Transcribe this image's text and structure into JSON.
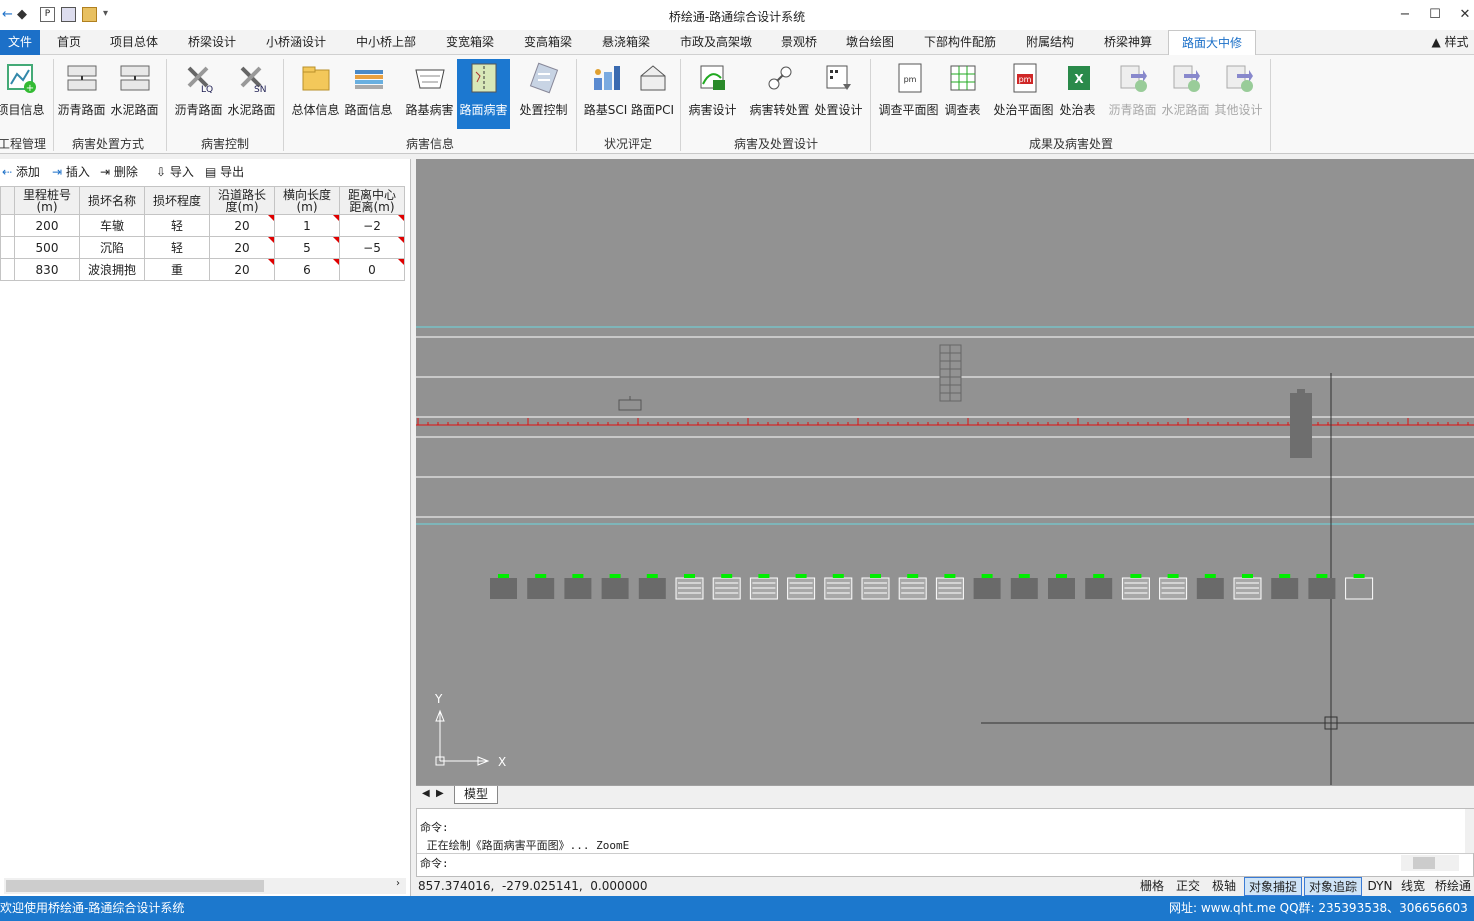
{
  "title": "桥绘通-路通综合设计系统",
  "titlebar": {
    "minimize": "−",
    "maximize": "☐",
    "close": "✕"
  },
  "menu": {
    "file": "文件",
    "items": [
      "首页",
      "项目总体",
      "桥梁设计",
      "小桥涵设计",
      "中小桥上部",
      "变宽箱梁",
      "变高箱梁",
      "悬浇箱梁",
      "市政及高架墩",
      "景观桥",
      "墩台绘图",
      "下部构件配筋",
      "附属结构",
      "桥梁神算",
      "路面大中修"
    ],
    "active": "路面大中修",
    "style": "▲ 样式"
  },
  "ribbon": {
    "buttons": [
      {
        "label": "项目信息",
        "icon": "project-info-icon"
      },
      {
        "label": "沥青路面",
        "icon": "asphalt-method-icon"
      },
      {
        "label": "水泥路面",
        "icon": "cement-method-icon"
      },
      {
        "label": "沥青路面",
        "icon": "asphalt-control-icon"
      },
      {
        "label": "水泥路面",
        "icon": "cement-control-icon"
      },
      {
        "label": "总体信息",
        "icon": "folder-icon"
      },
      {
        "label": "路面信息",
        "icon": "pavement-info-icon"
      },
      {
        "label": "路基病害",
        "icon": "subgrade-disease-icon"
      },
      {
        "label": "路面病害",
        "icon": "pavement-disease-icon",
        "selected": true
      },
      {
        "label": "处置控制",
        "icon": "disposal-control-icon"
      },
      {
        "label": "路基SCI",
        "icon": "sci-icon"
      },
      {
        "label": "路面PCI",
        "icon": "pci-icon"
      },
      {
        "label": "病害设计",
        "icon": "disease-design-icon"
      },
      {
        "label": "病害转处置",
        "icon": "disease-convert-icon"
      },
      {
        "label": "处置设计",
        "icon": "disposal-design-icon"
      },
      {
        "label": "调查平面图",
        "icon": "survey-plan-icon"
      },
      {
        "label": "调查表",
        "icon": "survey-table-icon"
      },
      {
        "label": "处治平面图",
        "icon": "treatment-plan-icon"
      },
      {
        "label": "处治表",
        "icon": "excel-icon"
      },
      {
        "label": "沥青路面",
        "icon": "asphalt-export-icon",
        "disabled": true
      },
      {
        "label": "水泥路面",
        "icon": "cement-export-icon",
        "disabled": true
      },
      {
        "label": "其他设计",
        "icon": "other-export-icon",
        "disabled": true
      }
    ],
    "groups": [
      "工程管理",
      "病害处置方式",
      "病害控制",
      "病害信息",
      "状况评定",
      "病害及处置设计",
      "成果及病害处置"
    ]
  },
  "toolbar": {
    "add": "添加",
    "insert": "插入",
    "delete": "删除",
    "import": "导入",
    "export": "导出"
  },
  "table": {
    "headers": [
      "里程桩号\n(m)",
      "损坏名称",
      "损坏程度",
      "沿道路长\n度(m)",
      "横向长度\n(m)",
      "距离中心\n距离(m)"
    ],
    "rows": [
      [
        "200",
        "车辙",
        "轻",
        "20",
        "1",
        "−2"
      ],
      [
        "500",
        "沉陷",
        "轻",
        "20",
        "5",
        "−5"
      ],
      [
        "830",
        "波浪拥抱",
        "重",
        "20",
        "6",
        "0"
      ]
    ]
  },
  "drawing": {
    "ucs_y": "Y",
    "ucs_x": "X"
  },
  "tabs": {
    "model": "模型"
  },
  "command": {
    "line1": "命令:",
    "line2": " 正在绘制《路面病害平面图》... ZoomE",
    "prompt": "命令:"
  },
  "status": {
    "coords": "857.374016,  -279.025141,  0.000000",
    "toggles": [
      {
        "label": "栅格",
        "on": false
      },
      {
        "label": "正交",
        "on": false
      },
      {
        "label": "极轴",
        "on": false
      },
      {
        "label": "对象捕捉",
        "on": true
      },
      {
        "label": "对象追踪",
        "on": true
      },
      {
        "label": "DYN",
        "on": false
      },
      {
        "label": "线宽",
        "on": false
      },
      {
        "label": "桥绘通",
        "on": false
      }
    ]
  },
  "footer": {
    "welcome": "欢迎使用桥绘通-路通综合设计系统",
    "contact": "网址: www.qht.me QQ群: 235393538、306656603"
  },
  "colors": {
    "accent": "#1c78cd",
    "canvas": "#929292",
    "redline": "#e01010",
    "cyan": "#6ad8e0",
    "green": "#00ee00"
  }
}
